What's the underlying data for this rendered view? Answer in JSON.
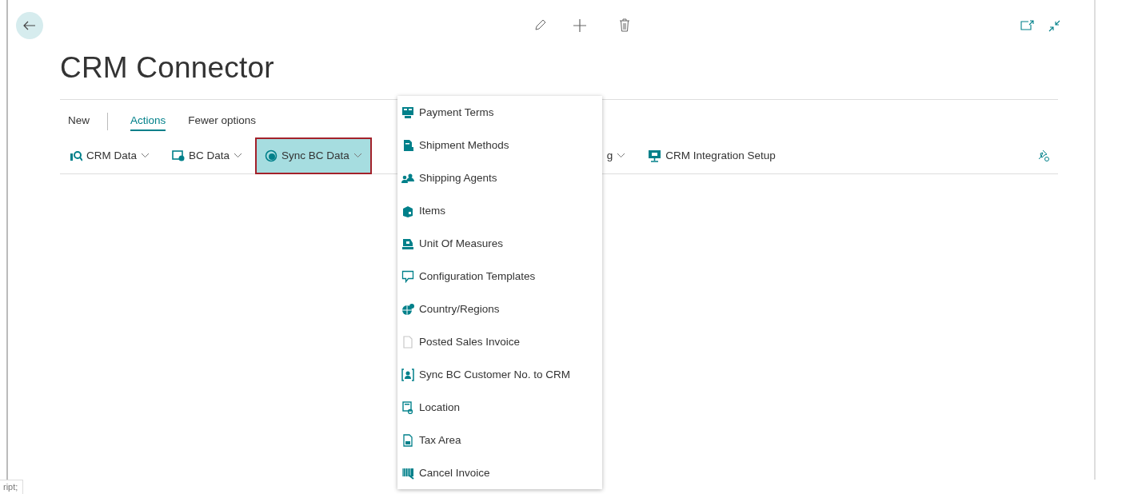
{
  "page": {
    "title": "CRM Connector"
  },
  "tabs": [
    {
      "label": "New",
      "selected": false
    },
    {
      "label": "Actions",
      "selected": true
    },
    {
      "label": "Fewer options",
      "selected": false
    }
  ],
  "actions": [
    {
      "label": "CRM Data",
      "dropdown": true,
      "selected": false,
      "kind": "magnifier"
    },
    {
      "label": "BC Data",
      "dropdown": true,
      "selected": false,
      "kind": "screen"
    },
    {
      "label": "Sync BC Data",
      "dropdown": true,
      "selected": true,
      "kind": "sync"
    },
    {
      "label": "g",
      "dropdown": true,
      "selected": false,
      "kind": "covered"
    },
    {
      "label": "CRM Integration Setup",
      "dropdown": false,
      "selected": false,
      "kind": "monitor"
    }
  ],
  "menu": {
    "items": [
      {
        "label": "Payment Terms",
        "disabled_icon": false
      },
      {
        "label": "Shipment Methods",
        "disabled_icon": false
      },
      {
        "label": "Shipping Agents",
        "disabled_icon": false
      },
      {
        "label": "Items",
        "disabled_icon": false
      },
      {
        "label": "Unit Of Measures",
        "disabled_icon": false
      },
      {
        "label": "Configuration Templates",
        "disabled_icon": false
      },
      {
        "label": "Country/Regions",
        "disabled_icon": false
      },
      {
        "label": "Posted Sales Invoice",
        "disabled_icon": true
      },
      {
        "label": "Sync BC Customer No. to CRM",
        "disabled_icon": false
      },
      {
        "label": "Location",
        "disabled_icon": false
      },
      {
        "label": "Tax Area",
        "disabled_icon": false
      },
      {
        "label": "Cancel Invoice",
        "disabled_icon": false
      }
    ]
  },
  "status_bar": {
    "text": "ript;"
  }
}
